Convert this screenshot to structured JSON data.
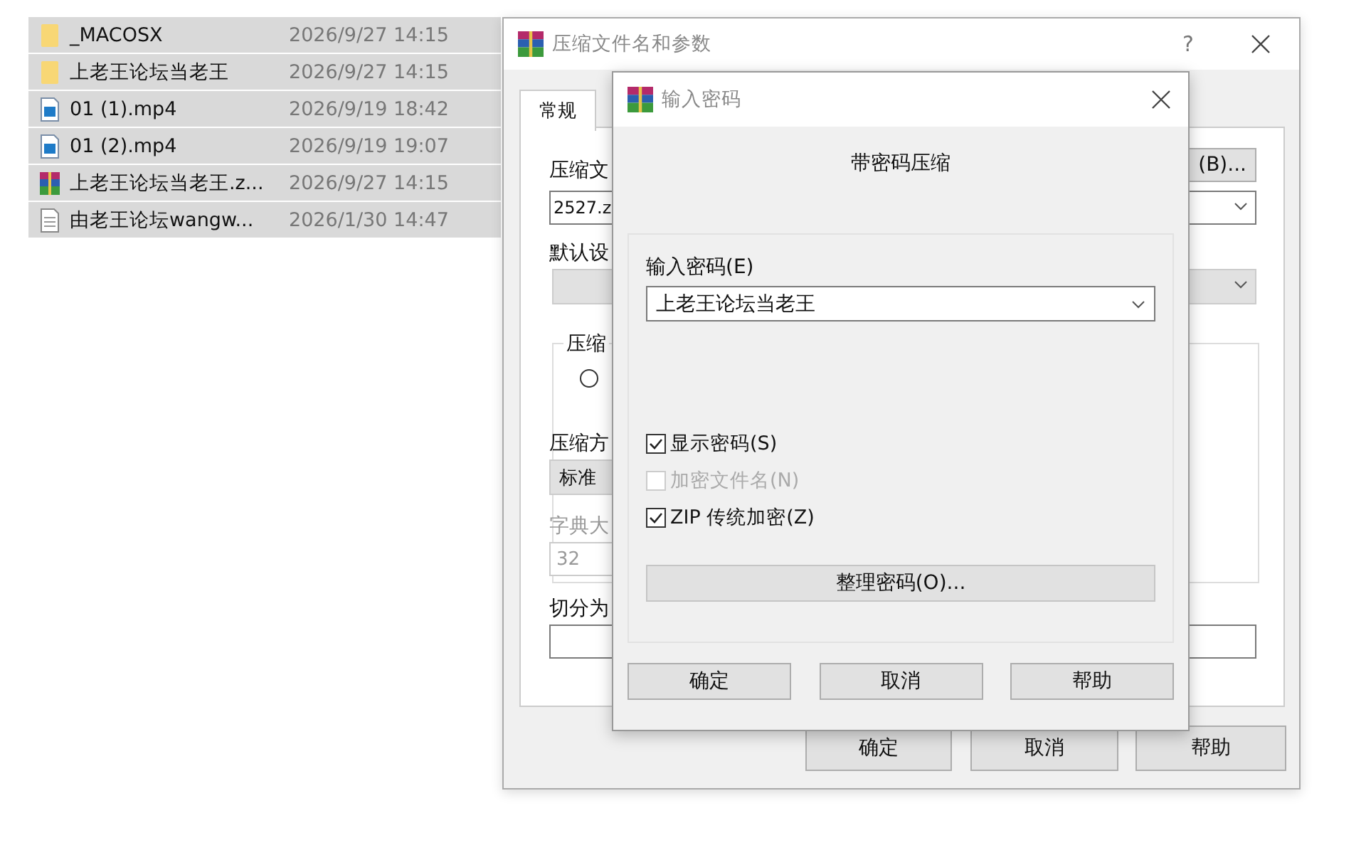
{
  "file_list": [
    {
      "name": "_MACOSX",
      "date": "2026/9/27 14:15",
      "kind": "folder",
      "selected": true
    },
    {
      "name": "上老王论坛当老王",
      "date": "2026/9/27 14:15",
      "kind": "folder",
      "selected": true
    },
    {
      "name": "01 (1).mp4",
      "date": "2026/9/19 18:42",
      "kind": "video",
      "selected": true
    },
    {
      "name": "01 (2).mp4",
      "date": "2026/9/19 19:07",
      "kind": "video",
      "selected": true
    },
    {
      "name": "上老王论坛当老王.z...",
      "date": "2026/9/27 14:15",
      "kind": "archive",
      "selected": true
    },
    {
      "name": "由老王论坛wangw...",
      "date": "2026/1/30 14:47",
      "kind": "text",
      "selected": true
    }
  ],
  "archive_dialog": {
    "title": "压缩文件名和参数",
    "help": "?",
    "tab": {
      "label": "常规",
      "selected": true
    },
    "archive_name_label": "压缩文",
    "archive_name_value": "2527.z",
    "browse_button": "(B)...",
    "profile_label": "默认设",
    "group_label": "压缩",
    "radio": {
      "selected": false
    },
    "method_label": "压缩方",
    "method_value": "标准",
    "dictionary_label": "字典大",
    "dictionary_value": "32",
    "split_label": "切分为",
    "buttons": [
      "确定",
      "取消",
      "帮助"
    ]
  },
  "password_dialog": {
    "title": "输入密码",
    "heading": "带密码压缩",
    "password_label": "输入密码(E)",
    "password_value": "上老王论坛当老王",
    "options": [
      {
        "label": "显示密码(S)",
        "checked": true,
        "disabled": false
      },
      {
        "label": "加密文件名(N)",
        "checked": false,
        "disabled": true
      },
      {
        "label": "ZIP 传统加密(Z)",
        "checked": true,
        "disabled": false
      }
    ],
    "organize_button": "整理密码(O)...",
    "buttons": [
      "确定",
      "取消",
      "帮助"
    ]
  }
}
